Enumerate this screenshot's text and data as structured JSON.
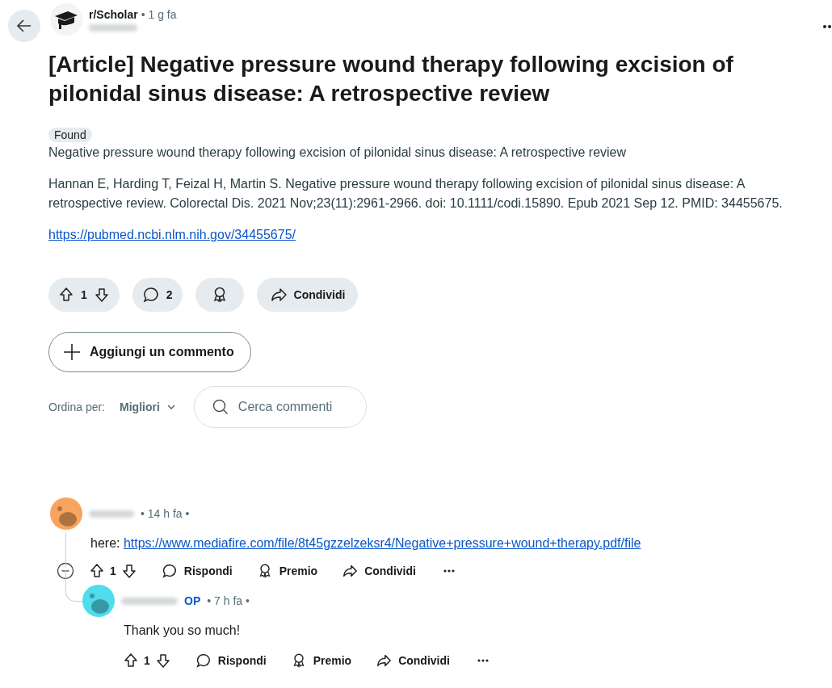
{
  "post": {
    "subreddit": "r/Scholar",
    "time": "• 1 g fa",
    "title": "[Article] Negative pressure wound therapy following excision of pilonidal sinus disease: A retrospective review",
    "flair": "Found",
    "subtitle": "Negative pressure wound therapy following excision of pilonidal sinus disease: A retrospective review",
    "citation": "Hannan E, Harding T, Feizal H, Martin S. Negative pressure wound therapy following excision of pilonidal sinus disease: A retrospective review. Colorectal Dis. 2021 Nov;23(11):2961-2966. doi: 10.1111/codi.15890. Epub 2021 Sep 12. PMID: 34455675.",
    "link": "https://pubmed.ncbi.nlm.nih.gov/34455675/"
  },
  "actions": {
    "votes": "1",
    "comments": "2",
    "share": "Condividi"
  },
  "add_comment": "Aggiungi un commento",
  "sort": {
    "label": "Ordina per:",
    "value": "Migliori"
  },
  "search": {
    "placeholder": "Cerca commenti"
  },
  "comments": [
    {
      "color": "#f9a45e",
      "time": "• 14 h fa •",
      "prefix": "here:",
      "link": "https://www.mediafire.com/file/8t45gzzelzeksr4/Negative+pressure+wound+therapy.pdf/file",
      "votes": "1",
      "reply": "Rispondi",
      "award": "Premio",
      "share": "Condividi",
      "children": [
        {
          "color": "#4fdcec",
          "op_label": "OP",
          "time": "• 7 h fa •",
          "text": "Thank you so much!",
          "votes": "1",
          "reply": "Rispondi",
          "award": "Premio",
          "share": "Condividi"
        }
      ]
    }
  ]
}
